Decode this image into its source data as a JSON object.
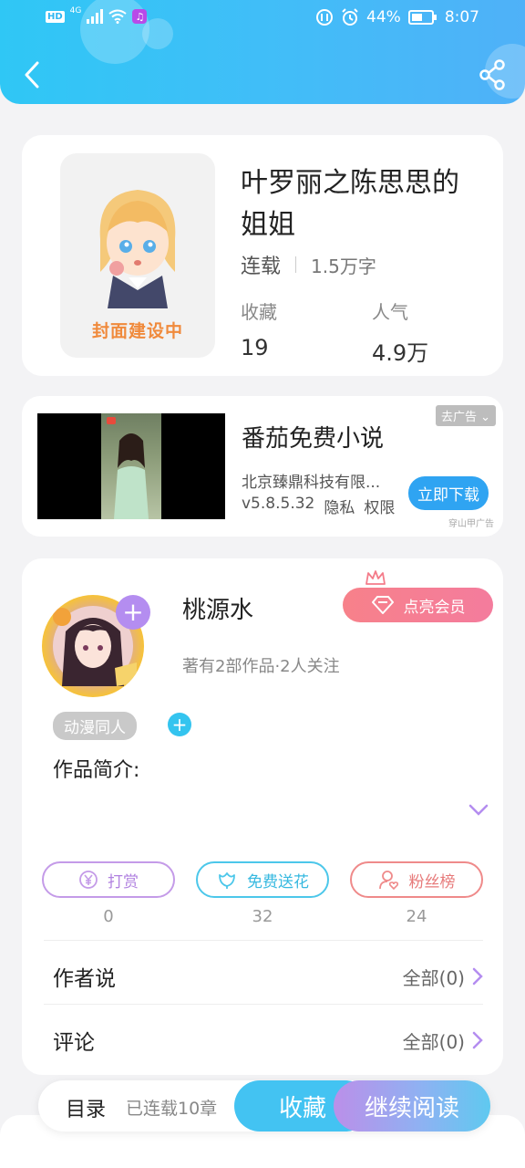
{
  "status_bar": {
    "network": "4G",
    "battery": "44%",
    "time": "8:07"
  },
  "book": {
    "cover_label": "封面建设中",
    "title": "叶罗丽之陈思思的姐姐",
    "status": "连载",
    "word_count": "1.5万字",
    "stats": [
      {
        "label": "收藏",
        "value": "19"
      },
      {
        "label": "人气",
        "value": "4.9万"
      }
    ]
  },
  "ad": {
    "title": "番茄免费小说",
    "company": "北京臻鼎科技有限...",
    "version": "v5.8.5.32",
    "privacy": "隐私",
    "permission": "权限",
    "close_label": "去广告",
    "download_label": "立即下载",
    "source": "穿山甲广告"
  },
  "author": {
    "name": "桃源水",
    "info": "著有2部作品·2人关注",
    "vip_label": "点亮会员",
    "tag": "动漫同人",
    "intro_label": "作品简介:"
  },
  "actions": [
    {
      "label": "打赏",
      "count": "0",
      "color": "#c49be8"
    },
    {
      "label": "免费送花",
      "count": "32",
      "color": "#4cc7ea"
    },
    {
      "label": "粉丝榜",
      "count": "24",
      "color": "#ef8a8a"
    }
  ],
  "rows": [
    {
      "title": "作者说",
      "right": "全部(0)"
    },
    {
      "title": "评论",
      "right": "全部(0)"
    }
  ],
  "bottom": {
    "toc_label": "目录",
    "toc_sub": "已连载10章",
    "favorite_label": "收藏",
    "read_label": "继续阅读"
  }
}
